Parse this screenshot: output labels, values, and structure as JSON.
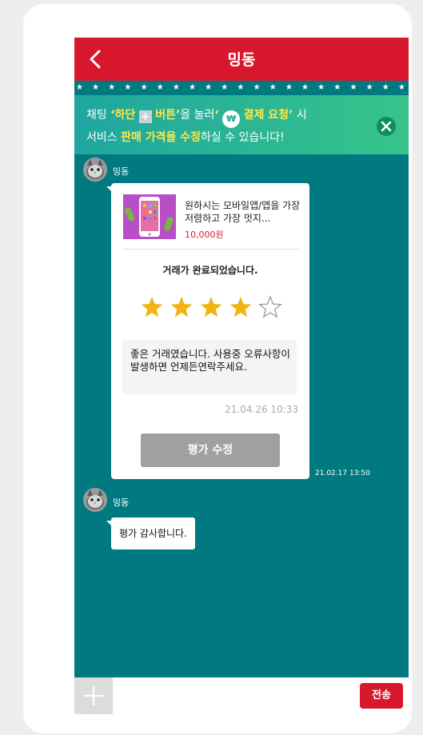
{
  "header": {
    "title": "밍동",
    "back_icon": "chevron-left-icon"
  },
  "decor": {
    "star_strip": "★ ★ ★ ★ ★ ★ ★ ★ ★ ★ ★ ★ ★ ★ ★ ★ ★ ★ ★ ★ ★"
  },
  "banner": {
    "part1": "채팅",
    "q_open": "‘",
    "hl1": "하단",
    "plus_glyph": "+",
    "hl2": "버튼",
    "q_close": "’",
    "part2": "을 눌러",
    "won_glyph": "₩",
    "hl3": "결제 요청",
    "part3": "시",
    "line2_part1": "서비스 ",
    "line2_hl": "판매 가격을 수정",
    "line2_part2": "하실 수 있습니다!",
    "close_icon": "close-icon"
  },
  "messages": [
    {
      "sender": "밍동",
      "avatar_icon": "cat-avatar",
      "time": "21.02.17 13:50",
      "product": {
        "description": "원하시는 모바일앱/앱을 가장 저렴하고 가장 멋지...",
        "price": "10,000원"
      },
      "status_text": "거래가 완료되었습니다.",
      "rating": 4,
      "rating_max": 5,
      "review": {
        "text": "좋은 거래였습니다. 사용중 오류사항이 발생하면 언제든연락주세요.",
        "time": "21.04.26 10:33"
      },
      "edit_button": "평가 수정"
    },
    {
      "sender": "밍동",
      "avatar_icon": "cat-avatar",
      "text": "평가 감사합니다."
    }
  ],
  "input_bar": {
    "placeholder": "",
    "send_label": "전송",
    "plus_icon": "plus-icon"
  },
  "colors": {
    "brand_red": "#d7182c",
    "chat_bg": "#007a80",
    "star_gold": "#f2b413",
    "highlight_yellow": "#ffe94a"
  }
}
